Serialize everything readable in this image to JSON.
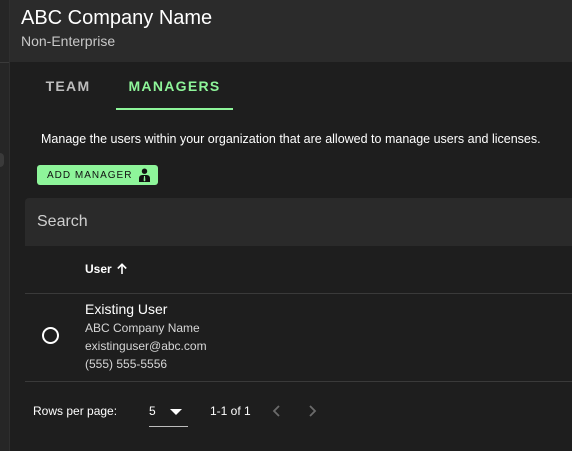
{
  "header": {
    "company_name": "ABC Company Name",
    "plan": "Non-Enterprise"
  },
  "tabs": [
    {
      "label": "TEAM",
      "active": false
    },
    {
      "label": "MANAGERS",
      "active": true
    }
  ],
  "managers": {
    "description": "Manage the users within your organization that are allowed to manage users and licenses.",
    "add_button_label": "ADD MANAGER",
    "add_button_icon": "manager-person-icon",
    "search_placeholder": "Search",
    "table": {
      "columns": [
        {
          "label": "User",
          "sort": "ascending",
          "sort_icon": "arrow-up-icon"
        }
      ],
      "rows": [
        {
          "selected": false,
          "name": "Existing User",
          "company": "ABC Company Name",
          "email": "existinguser@abc.com",
          "phone": "(555) 555-5556"
        }
      ]
    },
    "pagination": {
      "rows_per_page_label": "Rows per page:",
      "rows_per_page_value": "5",
      "range_text": "1-1 of 1",
      "prev_icon": "chevron-left-icon",
      "next_icon": "chevron-right-icon"
    }
  },
  "colors": {
    "accent": "#8ef59a",
    "background": "#1e1e1e",
    "header_background": "#2b2b2b",
    "input_background": "#2a2a2a"
  }
}
